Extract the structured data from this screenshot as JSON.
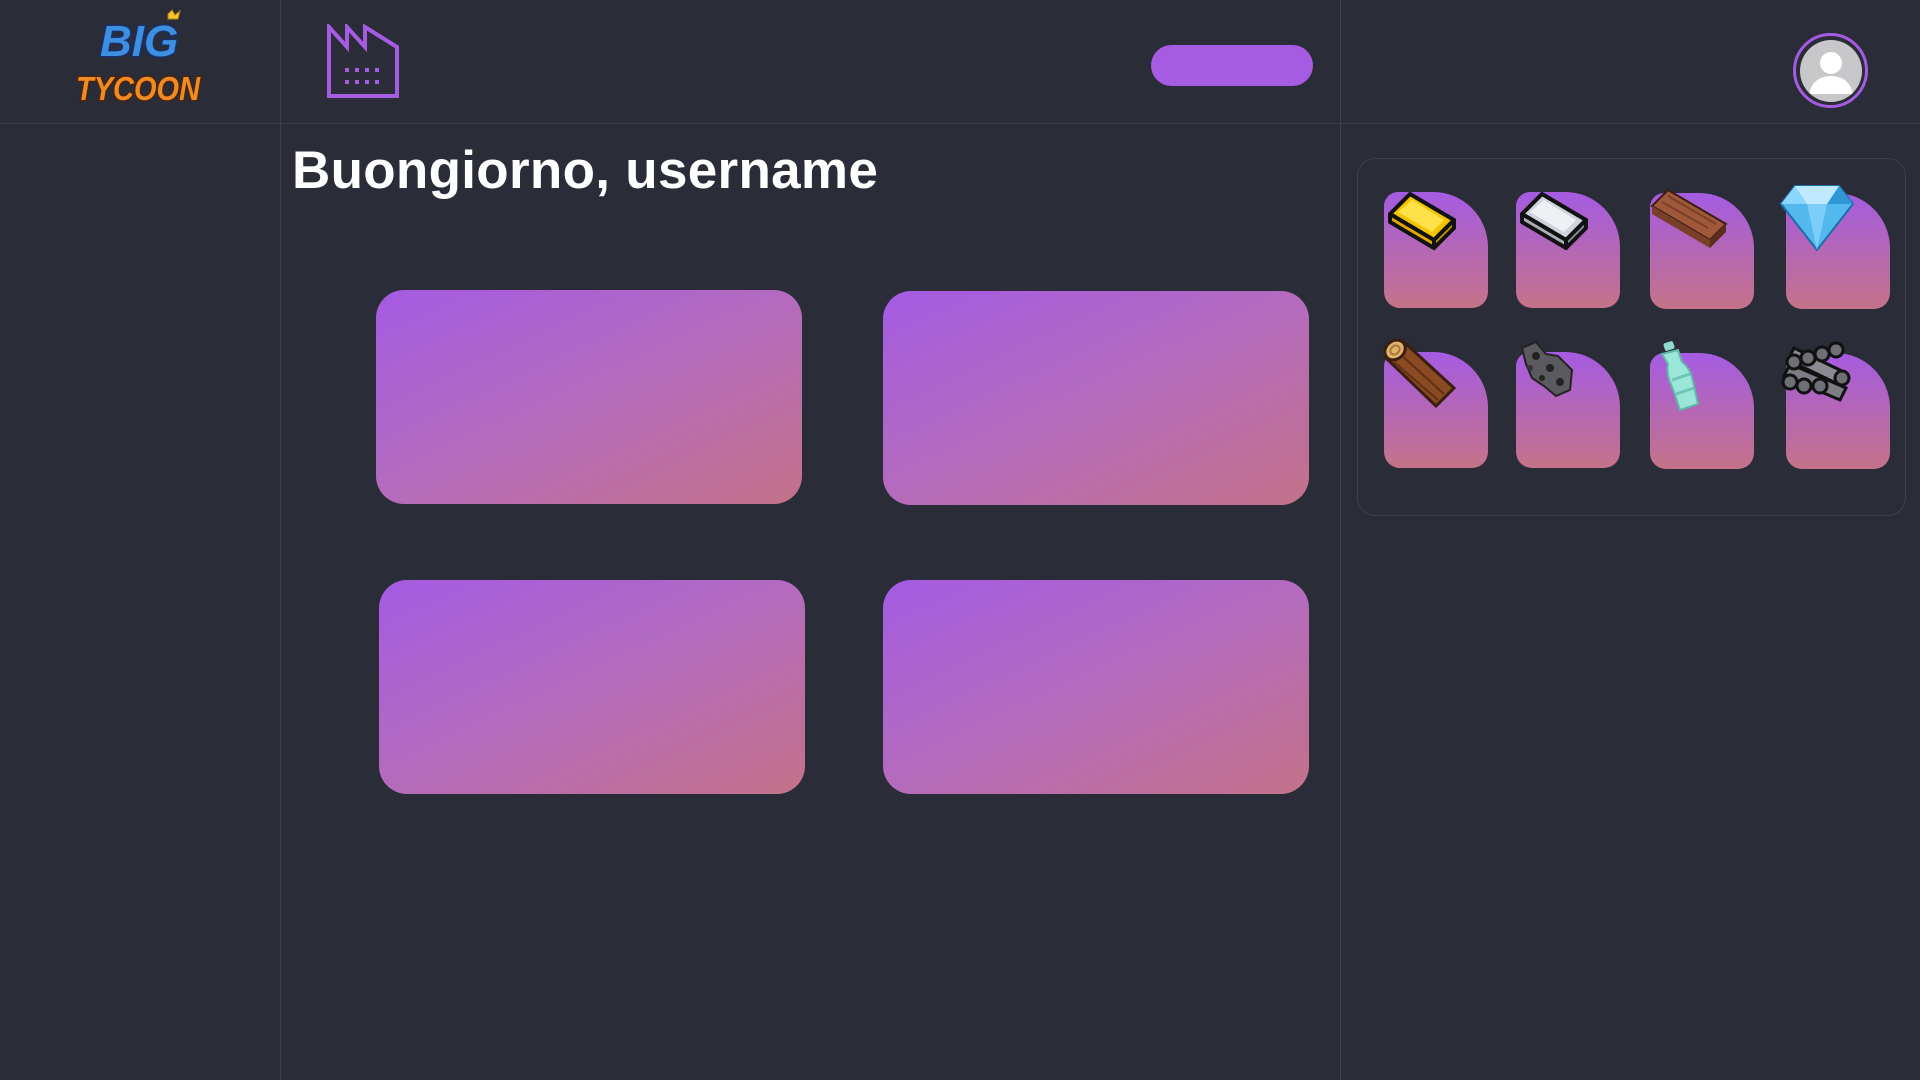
{
  "logo": {
    "line1": "BIG",
    "line2": "TYCOON"
  },
  "header": {
    "factory_icon": "factory-icon",
    "action_label": "",
    "avatar_icon": "user-avatar-icon"
  },
  "greeting": "Buongiorno, username",
  "cards": [
    {
      "label": ""
    },
    {
      "label": ""
    },
    {
      "label": ""
    },
    {
      "label": ""
    }
  ],
  "resources": [
    {
      "name": "gold-ingot-icon"
    },
    {
      "name": "silver-ingot-icon"
    },
    {
      "name": "wood-plank-icon"
    },
    {
      "name": "diamond-icon"
    },
    {
      "name": "log-icon"
    },
    {
      "name": "coal-ore-icon"
    },
    {
      "name": "plastic-bottle-icon"
    },
    {
      "name": "steel-pipes-icon"
    }
  ],
  "colors": {
    "background": "#2a2c37",
    "accent": "#a55be2",
    "gradient_end": "#c47388",
    "divider": "#3d404d"
  }
}
